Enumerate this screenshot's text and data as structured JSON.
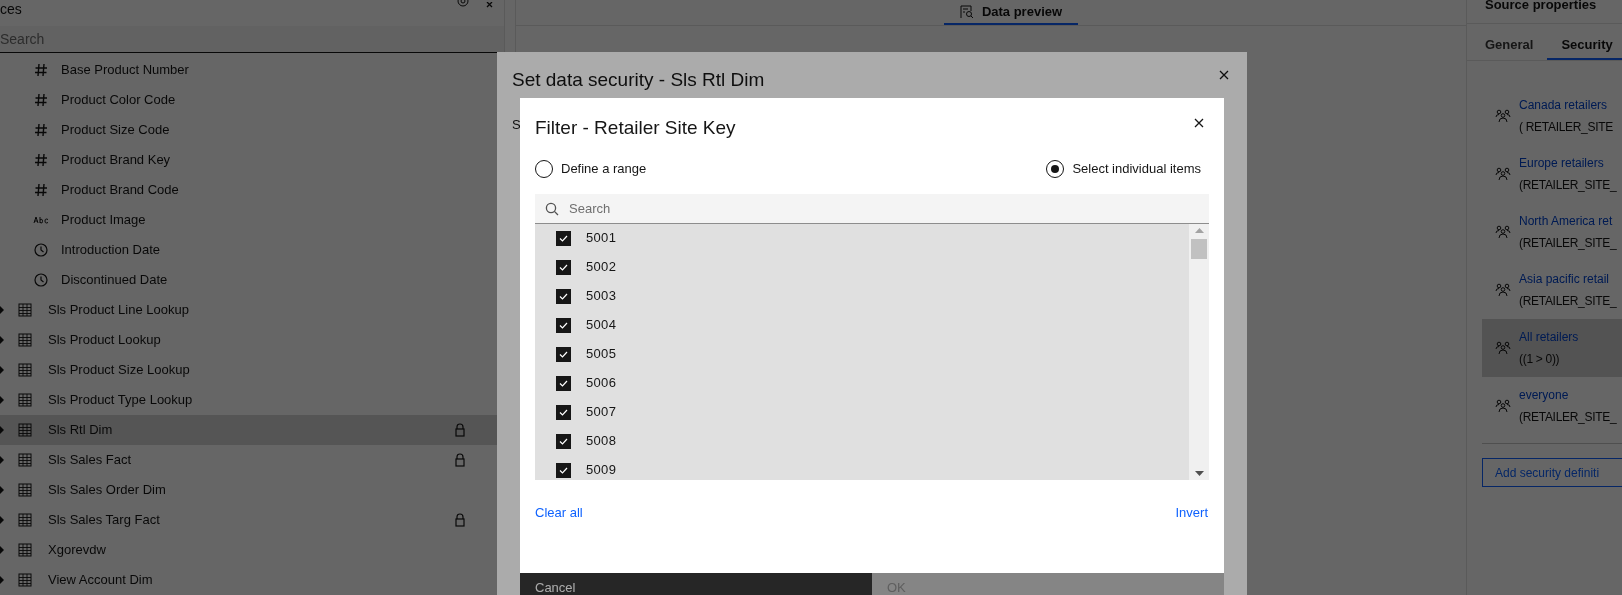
{
  "left_panel": {
    "title": "ces",
    "search": {
      "placeholder": "Search"
    },
    "columns": [
      {
        "kind": "number",
        "label": "Base Product Number"
      },
      {
        "kind": "number",
        "label": "Product Color Code"
      },
      {
        "kind": "number",
        "label": "Product Size Code"
      },
      {
        "kind": "number",
        "label": "Product Brand Key"
      },
      {
        "kind": "number",
        "label": "Product Brand Code"
      },
      {
        "kind": "text",
        "label": "Product Image"
      },
      {
        "kind": "date",
        "label": "Introduction Date"
      },
      {
        "kind": "date",
        "label": "Discontinued Date"
      }
    ],
    "tables": [
      {
        "label": "Sls Product Line Lookup",
        "expanded": false,
        "locked": false,
        "selected": false
      },
      {
        "label": "Sls Product Lookup",
        "expanded": false,
        "locked": false,
        "selected": false
      },
      {
        "label": "Sls Product Size Lookup",
        "expanded": false,
        "locked": false,
        "selected": false
      },
      {
        "label": "Sls Product Type Lookup",
        "expanded": false,
        "locked": false,
        "selected": false
      },
      {
        "label": "Sls Rtl Dim",
        "expanded": false,
        "locked": true,
        "selected": true
      },
      {
        "label": "Sls Sales Fact",
        "expanded": false,
        "locked": true,
        "selected": false
      },
      {
        "label": "Sls Sales Order Dim",
        "expanded": false,
        "locked": false,
        "selected": false
      },
      {
        "label": "Sls Sales Targ Fact",
        "expanded": false,
        "locked": true,
        "selected": false
      },
      {
        "label": "Xgorevdw",
        "expanded": false,
        "locked": false,
        "selected": false
      },
      {
        "label": "View Account Dim",
        "expanded": false,
        "locked": false,
        "selected": false
      }
    ]
  },
  "center": {
    "tabs": [
      {
        "label": "Data preview",
        "selected": true
      }
    ]
  },
  "right_panel": {
    "title": "Source properties",
    "tabs": [
      {
        "label": "General",
        "selected": false
      },
      {
        "label": "Security",
        "selected": true
      }
    ],
    "definitions": [
      {
        "name": "Canada retailers",
        "expression": "( RETAILER_SITE",
        "selected": false
      },
      {
        "name": "Europe retailers",
        "expression": "(RETAILER_SITE_",
        "selected": false
      },
      {
        "name": "North America ret",
        "expression": "(RETAILER_SITE_",
        "selected": false
      },
      {
        "name": "Asia pacific retail",
        "expression": "(RETAILER_SITE_",
        "selected": false
      },
      {
        "name": "All retailers",
        "expression": "((1 > 0))",
        "selected": true
      },
      {
        "name": "everyone",
        "expression": "(RETAILER_SITE_",
        "selected": false
      }
    ],
    "add_button": "Add security definiti"
  },
  "security_dialog": {
    "title": "Set data security - Sls Rtl Dim",
    "section_label": "S",
    "buttons": [
      {
        "label": "Cancel",
        "kind": "secondary",
        "disabled": false
      },
      {
        "label": "OK",
        "kind": "primary",
        "disabled": true
      }
    ]
  },
  "filter_dialog": {
    "title": "Filter - Retailer Site Key",
    "modes": [
      {
        "label": "Define a range",
        "selected": false
      },
      {
        "label": "Select individual items",
        "selected": true
      }
    ],
    "search": {
      "placeholder": "Search"
    },
    "items": [
      {
        "label": "5001",
        "checked": true
      },
      {
        "label": "5002",
        "checked": true
      },
      {
        "label": "5003",
        "checked": true
      },
      {
        "label": "5004",
        "checked": true
      },
      {
        "label": "5005",
        "checked": true
      },
      {
        "label": "5006",
        "checked": true
      },
      {
        "label": "5007",
        "checked": true
      },
      {
        "label": "5008",
        "checked": true
      },
      {
        "label": "5009",
        "checked": true
      }
    ],
    "actions": [
      {
        "label": "Clear all"
      },
      {
        "label": "Invert"
      }
    ]
  }
}
